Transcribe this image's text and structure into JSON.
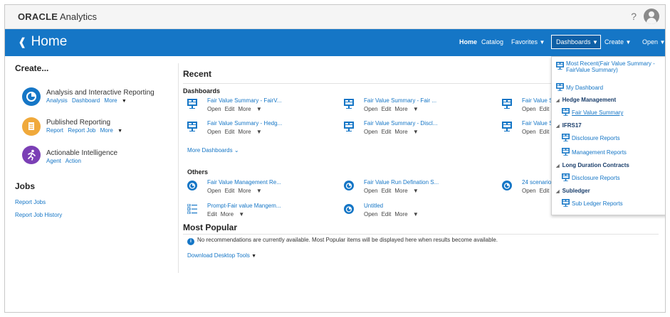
{
  "app": {
    "logo_brand": "ORACLE",
    "logo_product": "Analytics",
    "help_label": "?"
  },
  "header": {
    "title": "Home",
    "nav": {
      "home": "Home",
      "catalog": "Catalog",
      "favorites": "Favorites",
      "dashboards": "Dashboards",
      "create": "Create",
      "open": "Open"
    }
  },
  "create": {
    "heading": "Create...",
    "items": [
      {
        "title": "Analysis and Interactive Reporting",
        "links": [
          "Analysis",
          "Dashboard",
          "More"
        ],
        "color": "#1576c6"
      },
      {
        "title": "Published Reporting",
        "links": [
          "Report",
          "Report Job",
          "More"
        ],
        "color": "#f0a93b"
      },
      {
        "title": "Actionable Intelligence",
        "links": [
          "Agent",
          "Action"
        ],
        "color": "#7b3fb5"
      }
    ]
  },
  "jobs": {
    "heading": "Jobs",
    "links": [
      "Report Jobs",
      "Report Job History"
    ]
  },
  "recent": {
    "heading": "Recent",
    "dashboards_heading": "Dashboards",
    "dashboards": [
      {
        "name": "Fair Value Summary - FairV...",
        "actions": [
          "Open",
          "Edit",
          "More"
        ]
      },
      {
        "name": "Fair Value Summary - Fair ...",
        "actions": [
          "Open",
          "Edit",
          "More"
        ]
      },
      {
        "name": "Fair Value S",
        "actions": [
          "Open",
          "Edit"
        ]
      },
      {
        "name": "Fair Value Summary - Hedg...",
        "actions": [
          "Open",
          "Edit",
          "More"
        ]
      },
      {
        "name": "Fair Value Summary - Discl...",
        "actions": [
          "Open",
          "Edit",
          "More"
        ]
      },
      {
        "name": "Fair Value S",
        "actions": [
          "Open",
          "Edit"
        ]
      }
    ],
    "more_dashboards": "More Dashboards",
    "others_heading": "Others",
    "others": [
      {
        "name": "Fair Value Management Re...",
        "actions": [
          "Open",
          "Edit",
          "More"
        ],
        "icon": "analysis-icon"
      },
      {
        "name": "Fair Value Run Defination S...",
        "actions": [
          "Open",
          "Edit",
          "More"
        ],
        "icon": "analysis-icon"
      },
      {
        "name": "24 scenario",
        "actions": [
          "Open",
          "Edit"
        ],
        "icon": "analysis-icon"
      },
      {
        "name": "Prompt-Fair value Mangem...",
        "actions": [
          "Edit",
          "More"
        ],
        "icon": "prompt-icon"
      },
      {
        "name": "Untitled",
        "actions": [
          "Open",
          "Edit",
          "More"
        ],
        "icon": "analysis-icon"
      }
    ]
  },
  "popular": {
    "heading": "Most Popular",
    "message": "No recommendations are currently available. Most Popular items will be displayed here when results become available.",
    "download": "Download Desktop Tools"
  },
  "dashboards_menu": {
    "most_recent": "Most Recent(Fair Value Summary - FairValue Summary)",
    "most_recent_line1": "Most Recent(Fair Value Summary -",
    "most_recent_line2": "FairValue Summary)",
    "my_dashboard": "My Dashboard",
    "groups": [
      {
        "name": "Hedge Management",
        "items": [
          "Fair Value Summary"
        ]
      },
      {
        "name": "IFRS17",
        "items": [
          "Disclosure Reports",
          "Management Reports"
        ]
      },
      {
        "name": "Long Duration Contracts",
        "items": [
          "Disclosure Reports"
        ]
      },
      {
        "name": "Subledger",
        "items": [
          "Sub Ledger Reports"
        ]
      }
    ]
  },
  "colors": {
    "brand_blue": "#1576c6",
    "dropdown_active": "#0e5fa6"
  }
}
